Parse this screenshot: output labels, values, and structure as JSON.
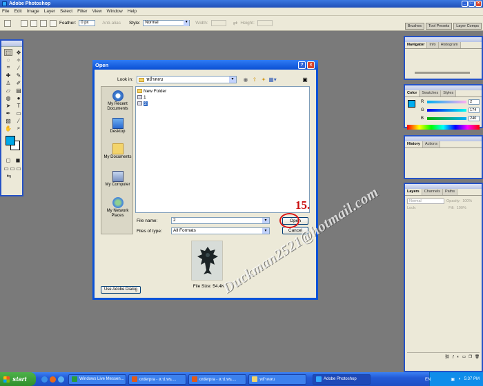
{
  "window": {
    "title": "Adobe Photoshop"
  },
  "menu": [
    "File",
    "Edit",
    "Image",
    "Layer",
    "Select",
    "Filter",
    "View",
    "Window",
    "Help"
  ],
  "options": {
    "feather_label": "Feather:",
    "feather_value": "0 px",
    "antialias_label": "Anti-alias",
    "style_label": "Style:",
    "style_value": "Normal",
    "width_label": "Width:",
    "height_label": "Height:"
  },
  "well_tabs": [
    "Brushes",
    "Tool Presets",
    "Layer Comps"
  ],
  "palettes": {
    "navigator_tabs": [
      "Navigator",
      "Info",
      "Histogram"
    ],
    "color_tabs": [
      "Color",
      "Swatches",
      "Styles"
    ],
    "color": {
      "r_label": "R",
      "r_value": "2",
      "g_label": "G",
      "g_value": "174",
      "b_label": "B",
      "b_value": "240",
      "fg_hex": "#02AEF0"
    },
    "history_tabs": [
      "History",
      "Actions"
    ],
    "layers_tabs": [
      "Layers",
      "Channels",
      "Paths"
    ],
    "layers": {
      "blend": "Normal",
      "opacity_label": "Opacity:",
      "opacity": "100%",
      "lock_label": "Lock:",
      "fill_label": "Fill:",
      "fill": "100%"
    }
  },
  "dialog": {
    "title": "Open",
    "look_in_label": "Look in:",
    "look_in_value": "หยำตลบ",
    "places": [
      "My Recent Documents",
      "Desktop",
      "My Documents",
      "My Computer",
      "My Network Places"
    ],
    "files": [
      {
        "name": "New Folder",
        "type": "folder",
        "selected": false
      },
      {
        "name": "1",
        "type": "file",
        "selected": false
      },
      {
        "name": "2",
        "type": "file",
        "selected": true
      }
    ],
    "file_name_label": "File name:",
    "file_name_value": "2",
    "files_of_type_label": "Files of type:",
    "files_of_type_value": "All Formats",
    "open_label": "Open",
    "cancel_label": "Cancel",
    "file_size": "File Size: 54.4K",
    "adobe_dialog_label": "Use Adobe Dialog"
  },
  "annotation": {
    "step": "15."
  },
  "watermark": "Duckman2521@hotmail.com",
  "taskbar": {
    "start": "start",
    "buttons": [
      {
        "label": "Windows Live Messen...",
        "active": false,
        "color": "#2a9d3a"
      },
      {
        "label": "orderpra - ส.ป.หน....",
        "active": false,
        "color": "#e05a1a"
      },
      {
        "label": "orderpra - ส.ป.หน....",
        "active": false,
        "color": "#e05a1a"
      },
      {
        "label": "หยำตลบ",
        "active": false,
        "color": "#f3d46b"
      },
      {
        "label": "Adobe Photoshop",
        "active": true,
        "color": "#31a8ff"
      }
    ],
    "lang": "EN",
    "clock": "5:37 PM"
  }
}
